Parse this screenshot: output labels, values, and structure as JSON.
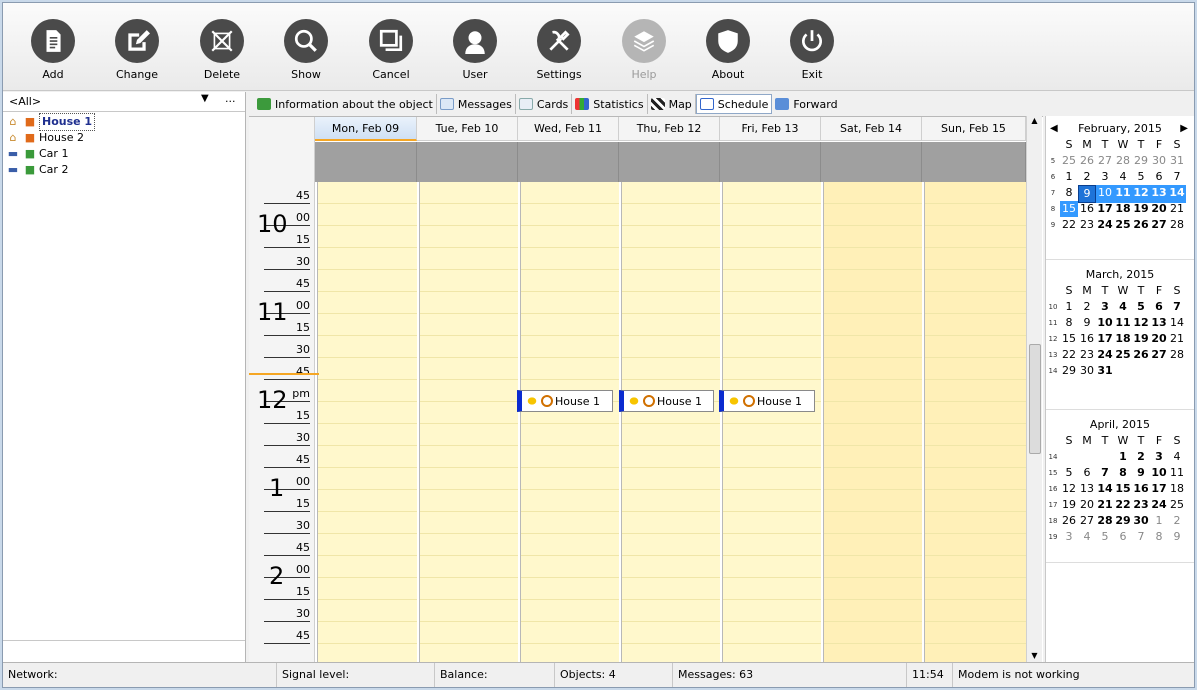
{
  "toolbar": {
    "buttons": [
      {
        "label": "Add",
        "icon": "document-icon"
      },
      {
        "label": "Change",
        "icon": "edit-icon"
      },
      {
        "label": "Delete",
        "icon": "delete-icon"
      },
      {
        "label": "Show",
        "icon": "search-icon"
      },
      {
        "label": "Cancel",
        "icon": "windows-icon"
      },
      {
        "label": "User",
        "icon": "user-icon"
      },
      {
        "label": "Settings",
        "icon": "tools-icon"
      },
      {
        "label": "Help",
        "icon": "layers-icon",
        "disabled": true
      },
      {
        "label": "About",
        "icon": "shield-icon"
      },
      {
        "label": "Exit",
        "icon": "power-icon"
      }
    ]
  },
  "objects": {
    "filter": "<All>",
    "filter_more": "...",
    "items": [
      {
        "label": "House 1",
        "type": "house",
        "selected": true
      },
      {
        "label": "House 2",
        "type": "house"
      },
      {
        "label": "Car 1",
        "type": "car"
      },
      {
        "label": "Car 2",
        "type": "car"
      }
    ]
  },
  "tabs": [
    {
      "label": "Information about the object"
    },
    {
      "label": "Messages"
    },
    {
      "label": "Cards"
    },
    {
      "label": "Statistics"
    },
    {
      "label": "Map"
    },
    {
      "label": "Schedule",
      "active": true
    },
    {
      "label": "Forward"
    }
  ],
  "schedule": {
    "days": [
      "Mon, Feb 09",
      "Tue, Feb 10",
      "Wed, Feb 11",
      "Thu, Feb 12",
      "Fri, Feb 13",
      "Sat, Feb 14",
      "Sun, Feb 15"
    ],
    "times": [
      "45",
      "00",
      "15",
      "30",
      "45",
      "00",
      "15",
      "30",
      "45",
      "pm",
      "15",
      "30",
      "45",
      "00",
      "15",
      "30",
      "45",
      "00",
      "15",
      "30",
      "45"
    ],
    "hours": [
      "10",
      "11",
      "12",
      "1",
      "2"
    ],
    "events": [
      {
        "label": "House 1"
      },
      {
        "label": "House 1"
      },
      {
        "label": "House 1"
      }
    ]
  },
  "calendars": [
    {
      "title": "February, 2015",
      "dow": [
        "S",
        "M",
        "T",
        "W",
        "T",
        "F",
        "S"
      ],
      "weeks": [
        {
          "wn": "5",
          "days": [
            "25",
            "26",
            "27",
            "28",
            "29",
            "30",
            "31"
          ]
        },
        {
          "wn": "6",
          "days": [
            "1",
            "2",
            "3",
            "4",
            "5",
            "6",
            "7"
          ]
        },
        {
          "wn": "7",
          "days": [
            "8",
            "9",
            "10",
            "11",
            "12",
            "13",
            "14"
          ]
        },
        {
          "wn": "8",
          "days": [
            "15",
            "16",
            "17",
            "18",
            "19",
            "20",
            "21"
          ]
        },
        {
          "wn": "9",
          "days": [
            "22",
            "23",
            "24",
            "25",
            "26",
            "27",
            "28"
          ]
        }
      ]
    },
    {
      "title": "March, 2015",
      "dow": [
        "S",
        "M",
        "T",
        "W",
        "T",
        "F",
        "S"
      ],
      "weeks": [
        {
          "wn": "10",
          "days": [
            "1",
            "2",
            "3",
            "4",
            "5",
            "6",
            "7"
          ]
        },
        {
          "wn": "11",
          "days": [
            "8",
            "9",
            "10",
            "11",
            "12",
            "13",
            "14"
          ]
        },
        {
          "wn": "12",
          "days": [
            "15",
            "16",
            "17",
            "18",
            "19",
            "20",
            "21"
          ]
        },
        {
          "wn": "13",
          "days": [
            "22",
            "23",
            "24",
            "25",
            "26",
            "27",
            "28"
          ]
        },
        {
          "wn": "14",
          "days": [
            "29",
            "30",
            "31",
            "",
            "",
            "",
            ""
          ]
        }
      ]
    },
    {
      "title": "April, 2015",
      "dow": [
        "S",
        "M",
        "T",
        "W",
        "T",
        "F",
        "S"
      ],
      "weeks": [
        {
          "wn": "14",
          "days": [
            "",
            "",
            "",
            "1",
            "2",
            "3",
            "4"
          ]
        },
        {
          "wn": "15",
          "days": [
            "5",
            "6",
            "7",
            "8",
            "9",
            "10",
            "11"
          ]
        },
        {
          "wn": "16",
          "days": [
            "12",
            "13",
            "14",
            "15",
            "16",
            "17",
            "18"
          ]
        },
        {
          "wn": "17",
          "days": [
            "19",
            "20",
            "21",
            "22",
            "23",
            "24",
            "25"
          ]
        },
        {
          "wn": "18",
          "days": [
            "26",
            "27",
            "28",
            "29",
            "30",
            "1",
            "2"
          ]
        },
        {
          "wn": "19",
          "days": [
            "3",
            "4",
            "5",
            "6",
            "7",
            "8",
            "9"
          ]
        }
      ]
    }
  ],
  "status": {
    "network": "Network:",
    "signal": "Signal level:",
    "balance": "Balance:",
    "objects": "Objects: 4",
    "messages": "Messages: 63",
    "time": "11:54",
    "modem": "Modem is not working"
  },
  "colors": {
    "accent": "#3399ff",
    "event_bar": "#0a2bd0",
    "workday": "#fff8cc",
    "weekend": "#fff0b8"
  }
}
